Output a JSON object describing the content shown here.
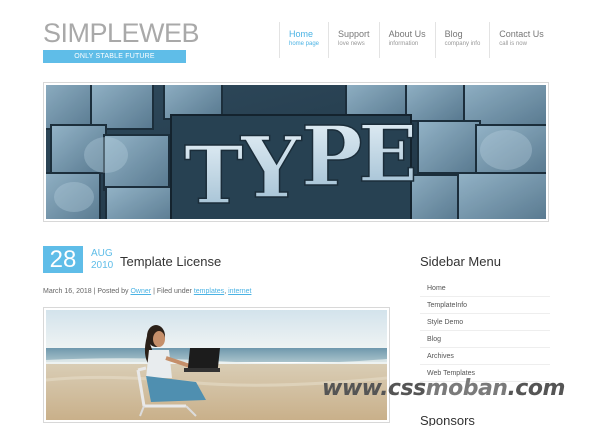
{
  "logo": {
    "title": "SIMPLEWEB",
    "tagline": "ONLY STABLE FUTURE"
  },
  "nav": [
    {
      "title": "Home",
      "subtitle": "home page",
      "active": true
    },
    {
      "title": "Support",
      "subtitle": "love news",
      "active": false
    },
    {
      "title": "About Us",
      "subtitle": "information",
      "active": false
    },
    {
      "title": "Blog",
      "subtitle": "company info",
      "active": false
    },
    {
      "title": "Contact Us",
      "subtitle": "call is now",
      "active": false
    }
  ],
  "banner": {
    "letters": [
      "T",
      "Y",
      "P",
      "E"
    ]
  },
  "post": {
    "day": "28",
    "month": "AUG",
    "year": "2010",
    "title": "Template License",
    "meta": {
      "date": "March 16, 2018",
      "sep1": "|",
      "posted_by_label": "Posted by",
      "author": "Owner",
      "sep2": "|",
      "filed_label": "Filed under",
      "tag1": "templates",
      "comma": ",",
      "tag2": "internet"
    }
  },
  "sidebar": {
    "title": "Sidebar Menu",
    "items": [
      "Home",
      "TemplateInfo",
      "Style Demo",
      "Blog",
      "Archives",
      "Web Templates"
    ],
    "sponsors_title": "Sponsors"
  },
  "watermark": {
    "part1": "www.css",
    "part2": "moban",
    "part3": ".com"
  },
  "colors": {
    "accent": "#5fbde8",
    "text": "#333333",
    "muted": "#a9a9a9"
  }
}
